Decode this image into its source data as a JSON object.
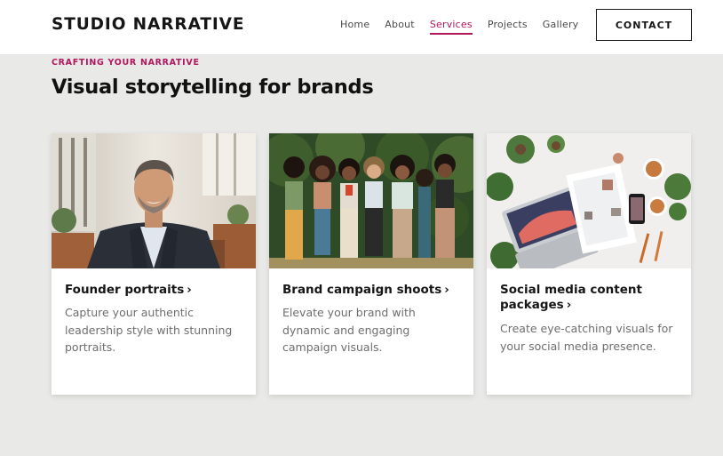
{
  "header": {
    "logo": "STUDIO NARRATIVE",
    "nav": [
      {
        "label": "Home",
        "active": false
      },
      {
        "label": "About",
        "active": false
      },
      {
        "label": "Services",
        "active": true
      },
      {
        "label": "Projects",
        "active": false
      },
      {
        "label": "Gallery",
        "active": false
      }
    ],
    "contact_label": "CONTACT"
  },
  "hero": {
    "kicker": "CRAFTING YOUR NARRATIVE",
    "headline": "Visual storytelling for brands"
  },
  "cards": [
    {
      "title": "Founder portraits",
      "description": "Capture your authentic leadership style with stunning portraits."
    },
    {
      "title": "Brand campaign shoots",
      "description": "Elevate your brand with dynamic and engaging campaign visuals."
    },
    {
      "title": "Social media content packages",
      "description": "Create eye-catching visuals for your social media presence."
    }
  ],
  "colors": {
    "accent": "#b0175e",
    "background": "#e9e9e8",
    "card": "#ffffff",
    "text": "#161616",
    "muted": "#6e6e6e"
  }
}
